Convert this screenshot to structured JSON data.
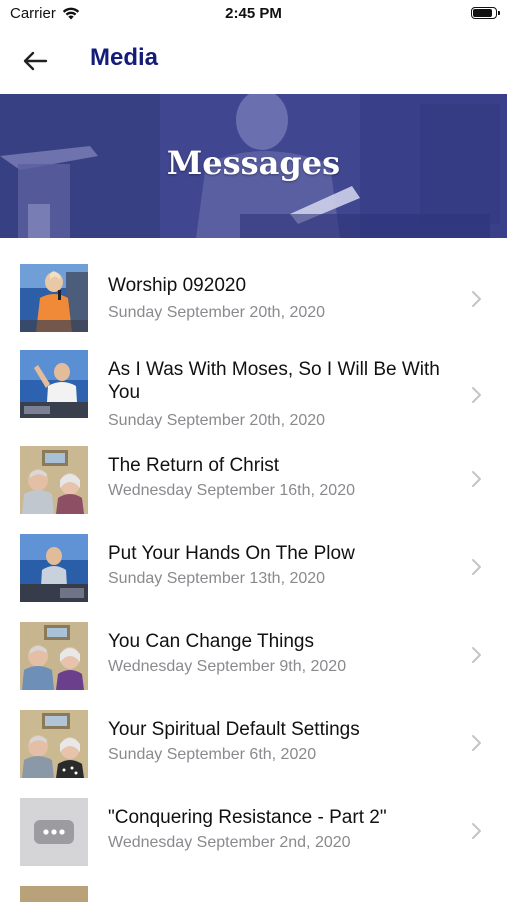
{
  "status_bar": {
    "carrier": "Carrier",
    "time": "2:45 PM",
    "battery_level": 0.9
  },
  "nav": {
    "title": "Media"
  },
  "banner": {
    "title": "Messages"
  },
  "messages": [
    {
      "title": "Worship 092020",
      "date": "Sunday September 20th, 2020",
      "thumb": "woman-singing-orange"
    },
    {
      "title": "As I Was With Moses, So I Will Be With You",
      "date": "Sunday September 20th, 2020",
      "thumb": "man-raising-hand"
    },
    {
      "title": "The Return of Christ",
      "date": "Wednesday September 16th, 2020",
      "thumb": "couple-living-room"
    },
    {
      "title": "Put Your Hands On The Plow",
      "date": "Sunday September 13th, 2020",
      "thumb": "man-preaching-stage"
    },
    {
      "title": "You Can Change Things",
      "date": "Wednesday September 9th, 2020",
      "thumb": "couple-living-room"
    },
    {
      "title": "Your Spiritual Default Settings",
      "date": "Sunday September 6th, 2020",
      "thumb": "couple-living-room"
    },
    {
      "title": "\"Conquering Resistance - Part 2\"",
      "date": "Wednesday September 2nd, 2020",
      "thumb": "placeholder-ellipsis"
    }
  ]
}
